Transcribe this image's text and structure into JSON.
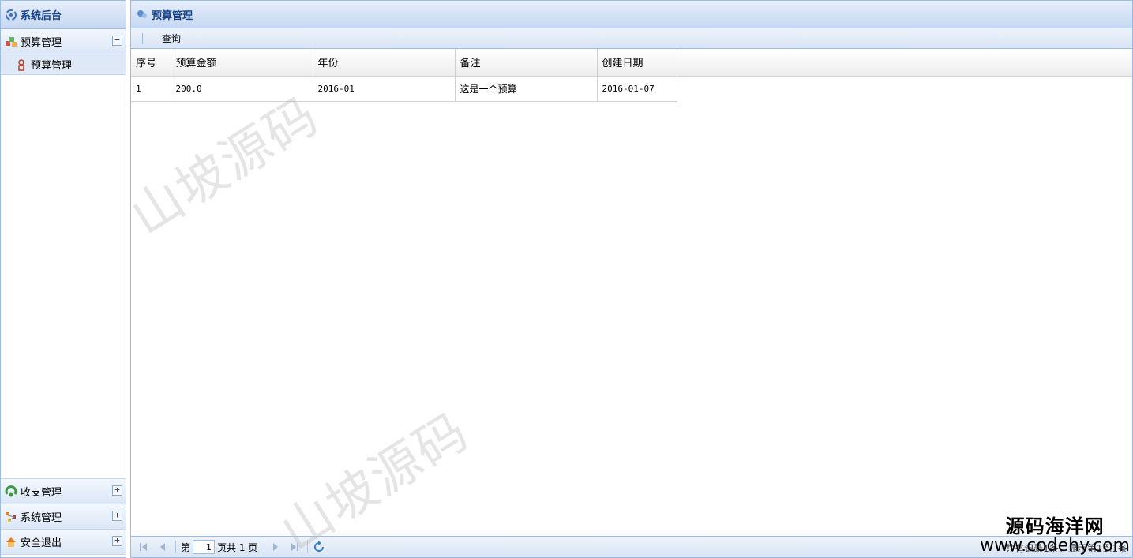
{
  "sidebar": {
    "title": "系统后台",
    "sections": [
      {
        "label": "预算管理",
        "toggle": "−",
        "items": [
          {
            "label": "预算管理"
          }
        ]
      },
      {
        "label": "收支管理",
        "toggle": "+"
      },
      {
        "label": "系统管理",
        "toggle": "+"
      },
      {
        "label": "安全退出",
        "toggle": "+"
      }
    ]
  },
  "main": {
    "title": "预算管理",
    "toolbar": {
      "query_label": "查询"
    },
    "table": {
      "columns": [
        "序号",
        "预算金额",
        "年份",
        "备注",
        "创建日期"
      ],
      "rows": [
        [
          "1",
          "200.0",
          "2016-01",
          "这是一个预算",
          "2016-01-07"
        ]
      ]
    },
    "pager": {
      "page_prefix": "第",
      "page_value": "1",
      "page_suffix": "页共 1 页",
      "info": "共有记录1条，显示第1到1条"
    }
  },
  "watermarks": {
    "text": "山坡源码",
    "site_line1": "源码海洋网",
    "site_line2": "www.codehy.com"
  },
  "colors": {
    "header_text": "#15428b",
    "border": "#99bbe8",
    "selected_row": "#dfe8f6"
  },
  "icons": {
    "sidebar_title": "gear-refresh-icon",
    "section_budget": "cubes-icon",
    "tree_item": "user-icon",
    "section_income": "recycle-icon",
    "section_system": "nodes-icon",
    "section_logout": "home-icon",
    "main_title": "panel-icon",
    "pager_refresh": "refresh-icon"
  }
}
